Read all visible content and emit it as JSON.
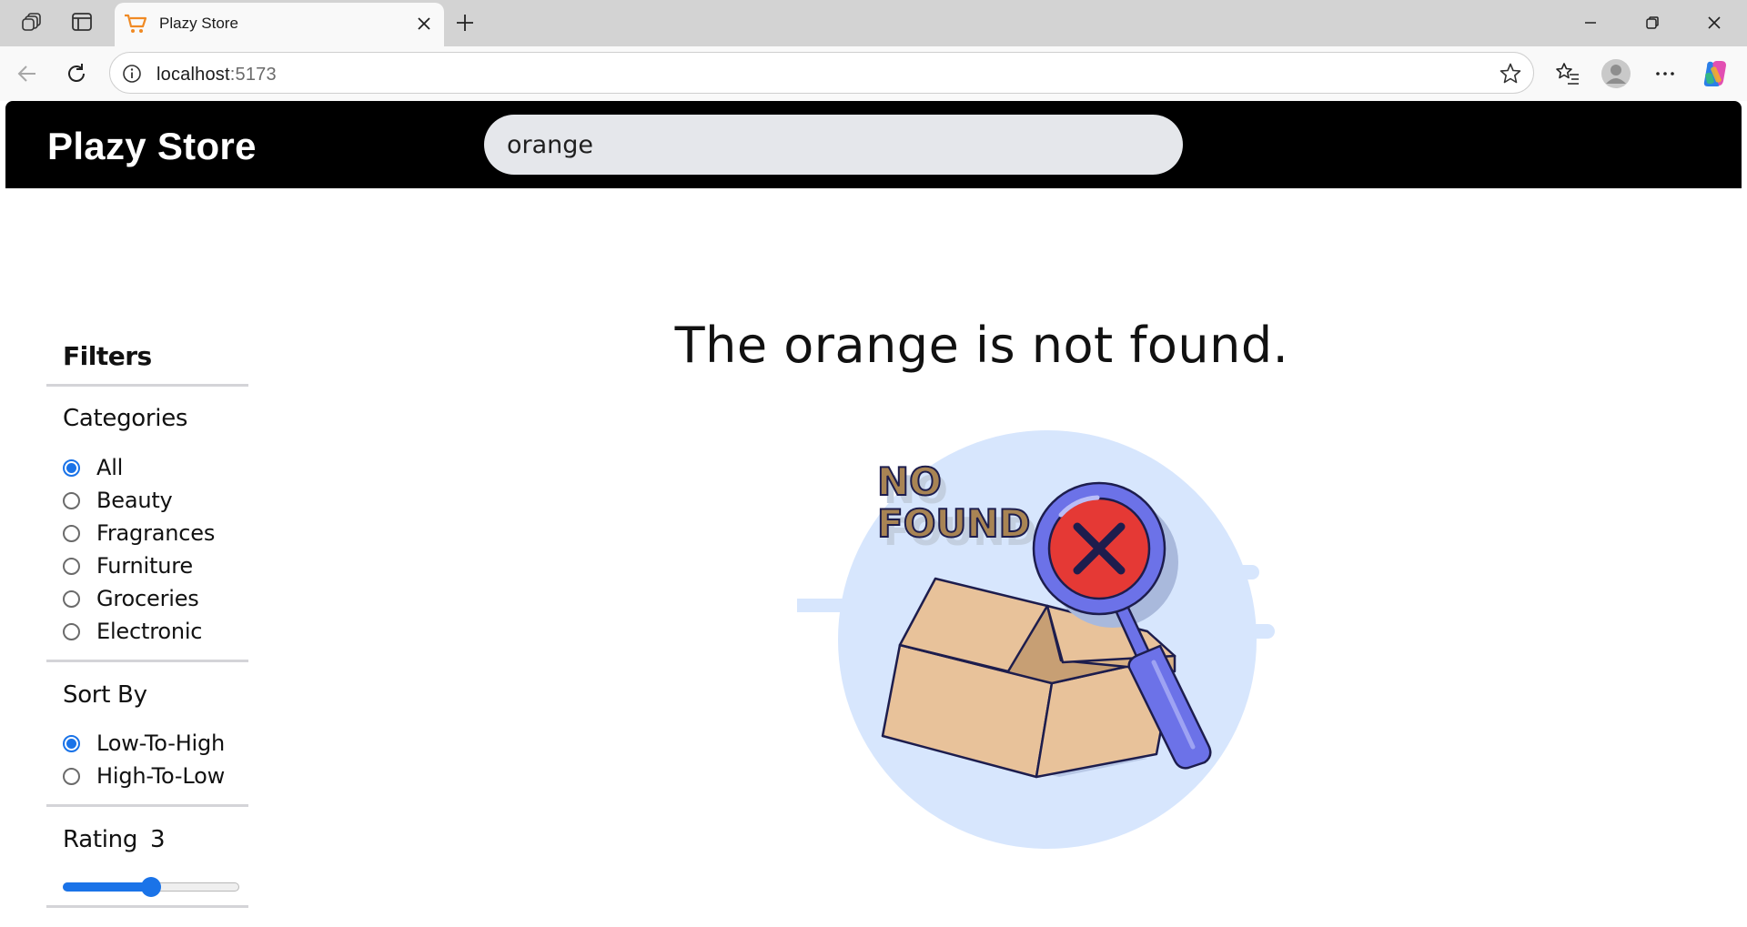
{
  "browser": {
    "tab_title": "Plazy Store",
    "url_host": "localhost",
    "url_port": ":5173"
  },
  "site": {
    "brand": "Plazy Store",
    "search_value": "orange"
  },
  "filters": {
    "title": "Filters",
    "categories_title": "Categories",
    "categories": [
      {
        "label": "All",
        "checked": true
      },
      {
        "label": "Beauty",
        "checked": false
      },
      {
        "label": "Fragrances",
        "checked": false
      },
      {
        "label": "Furniture",
        "checked": false
      },
      {
        "label": "Groceries",
        "checked": false
      },
      {
        "label": "Electronic",
        "checked": false
      }
    ],
    "sort_title": "Sort By",
    "sort_options": [
      {
        "label": "Low-To-High",
        "checked": true
      },
      {
        "label": "High-To-Low",
        "checked": false
      }
    ],
    "rating_title": "Rating",
    "rating_value": "3",
    "rating_fraction": 0.5
  },
  "main": {
    "message": "The orange is not found.",
    "illustration_text_1": "NO",
    "illustration_text_2": "FOUND"
  },
  "colors": {
    "accent": "#1a73e8",
    "header_bg": "#000000",
    "search_bg": "#e5e7eb"
  }
}
